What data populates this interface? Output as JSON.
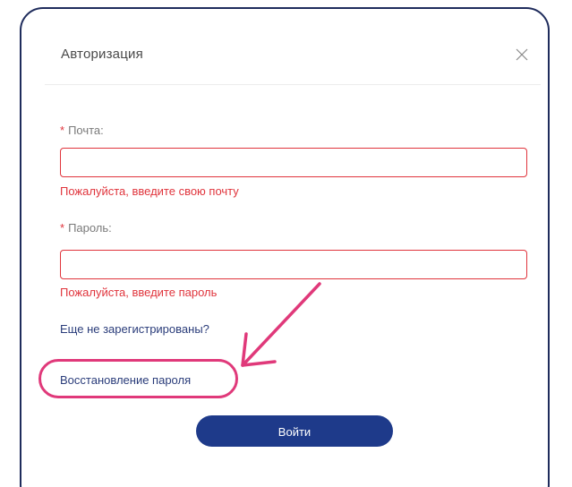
{
  "modal": {
    "title": "Авторизация",
    "close_label": "X"
  },
  "email": {
    "required_mark": "*",
    "label": "Почта:",
    "value": "",
    "error": "Пожалуйста, введите свою почту"
  },
  "password": {
    "required_mark": "*",
    "label": "Пароль:",
    "value": "",
    "error": "Пожалуйста, введите пароль"
  },
  "links": {
    "register": "Еще не зарегистрированы?",
    "recover": "Восстановление пароля"
  },
  "submit_label": "Войти",
  "colors": {
    "frame": "#1f2c5c",
    "error": "#e0343c",
    "link": "#2a3c7a",
    "button": "#1e3a8a",
    "annotation": "#e0397a"
  }
}
